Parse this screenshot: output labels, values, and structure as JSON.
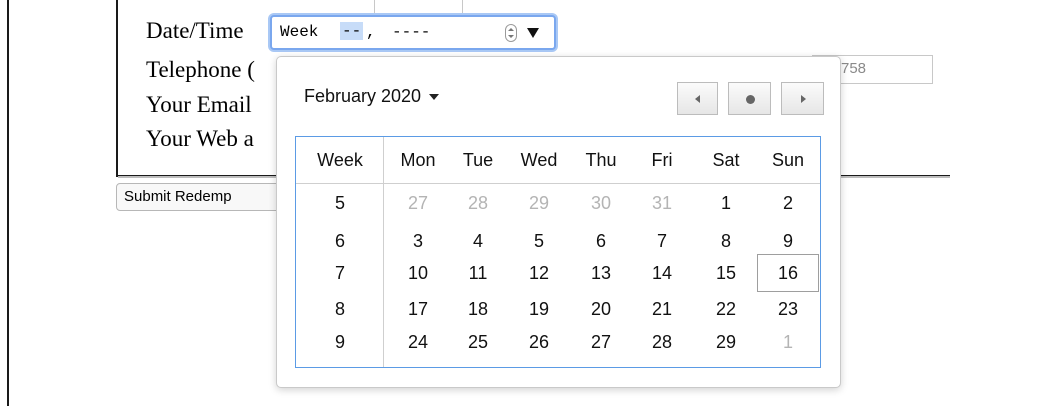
{
  "form": {
    "date_label": "Date/Time",
    "telephone_label": "Telephone (",
    "email_label": "Your Email",
    "web_label": "Your Web a",
    "telephone_value": "758",
    "submit_label": "Submit Redemp"
  },
  "week_input": {
    "prefix": "Week",
    "week_segment": "--",
    "separator": ",",
    "year_segment": "----"
  },
  "picker": {
    "month_label": "February 2020",
    "headers": [
      "Week",
      "Mon",
      "Tue",
      "Wed",
      "Thu",
      "Fri",
      "Sat",
      "Sun"
    ],
    "rows": [
      {
        "week": "5",
        "days": [
          "27",
          "28",
          "29",
          "30",
          "31",
          "1",
          "2"
        ]
      },
      {
        "week": "6",
        "days": [
          "3",
          "4",
          "5",
          "6",
          "7",
          "8",
          "9"
        ]
      },
      {
        "week": "7",
        "days": [
          "10",
          "11",
          "12",
          "13",
          "14",
          "15",
          "16"
        ]
      },
      {
        "week": "8",
        "days": [
          "17",
          "18",
          "19",
          "20",
          "21",
          "22",
          "23"
        ]
      },
      {
        "week": "9",
        "days": [
          "24",
          "25",
          "26",
          "27",
          "28",
          "29",
          "1"
        ]
      }
    ],
    "muted_days": [
      [
        0,
        0
      ],
      [
        0,
        1
      ],
      [
        0,
        2
      ],
      [
        0,
        3
      ],
      [
        0,
        4
      ],
      [
        4,
        6
      ]
    ],
    "today_cell": [
      2,
      6
    ]
  },
  "colors": {
    "accent": "#5b9be5",
    "muted_text": "#b4b4b4"
  },
  "icons": {
    "spin": "spin-button-icon",
    "dropdown": "dropdown-arrow-icon",
    "prev": "previous-month-icon",
    "today": "today-dot-icon",
    "next": "next-month-icon"
  }
}
